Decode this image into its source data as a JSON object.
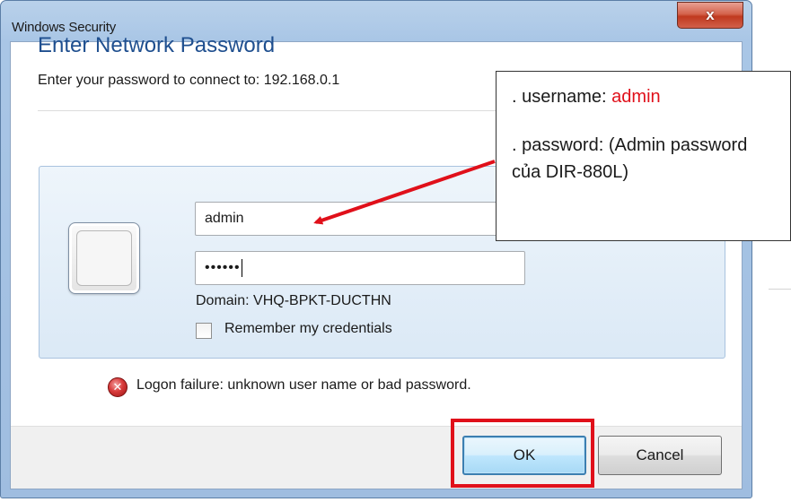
{
  "window": {
    "title": "Windows Security",
    "close_label": "x"
  },
  "dialog": {
    "heading": "Enter Network Password",
    "subheading": "Enter your password to connect to: 192.168.0.1",
    "username_value": "admin",
    "password_mask": "••••••",
    "domain": "Domain: VHQ-BPKT-DUCTHN",
    "remember_label": "Remember my credentials",
    "remember_checked": false,
    "error_message": "Logon failure: unknown user name or bad password.",
    "ok_label": "OK",
    "cancel_label": "Cancel"
  },
  "annotation": {
    "username_prefix": ". username: ",
    "username_value": "admin",
    "password_text": ". password: (Admin password của DIR-880L)"
  },
  "colors": {
    "heading": "#1f4f8f",
    "highlight_red": "#e0101a",
    "close_button": "#c0391f"
  },
  "icons": {
    "close": "close-icon",
    "error": "error-icon",
    "credential_tile": "credential-tile-icon"
  }
}
